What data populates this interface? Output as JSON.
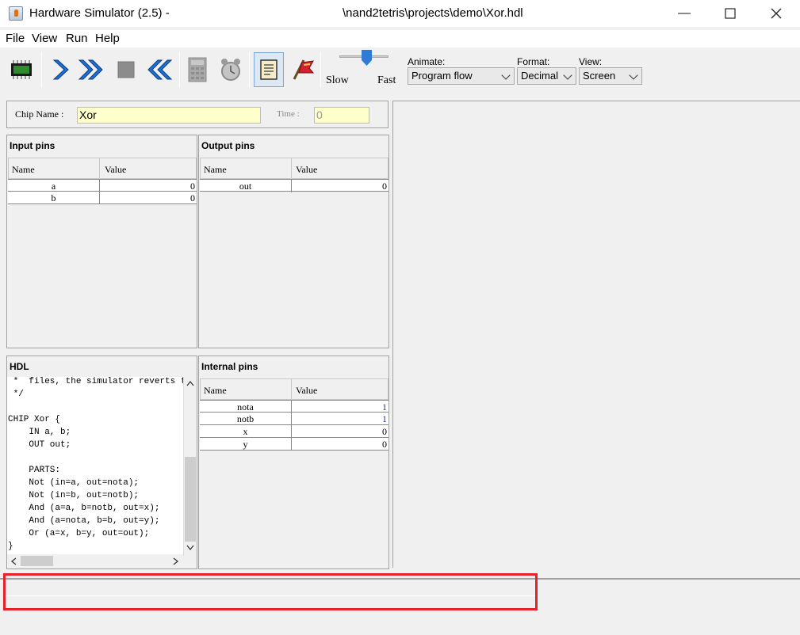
{
  "window": {
    "title": "Hardware Simulator (2.5) -",
    "path": "\\nand2tetris\\projects\\demo\\Xor.hdl",
    "minimize_glyph": "—",
    "maximize_glyph": "☐",
    "close_glyph": "✕"
  },
  "menu": {
    "file": "File",
    "view": "View",
    "run": "Run",
    "help": "Help"
  },
  "toolbar": {
    "speed_slow": "Slow",
    "speed_fast": "Fast",
    "speed_level": 0.55,
    "animate_label": "Animate:",
    "animate_value": "Program flow",
    "format_label": "Format:",
    "format_value": "Decimal",
    "view_label": "View:",
    "view_value": "Screen"
  },
  "chip": {
    "name_label": "Chip Name :",
    "name_value": "Xor",
    "time_label": "Time :",
    "time_value": "0"
  },
  "input_pins": {
    "title": "Input pins",
    "col_name": "Name",
    "col_value": "Value",
    "rows": [
      {
        "name": "a",
        "value": "0"
      },
      {
        "name": "b",
        "value": "0"
      }
    ]
  },
  "output_pins": {
    "title": "Output pins",
    "col_name": "Name",
    "col_value": "Value",
    "rows": [
      {
        "name": "out",
        "value": "0"
      }
    ]
  },
  "internal_pins": {
    "title": "Internal pins",
    "col_name": "Name",
    "col_value": "Value",
    "rows": [
      {
        "name": "nota",
        "value": "1"
      },
      {
        "name": "notb",
        "value": "1"
      },
      {
        "name": "x",
        "value": "0"
      },
      {
        "name": "y",
        "value": "0"
      }
    ]
  },
  "hdl": {
    "title": "HDL",
    "lines": [
      " *  files, the simulator reverts to u",
      " */",
      "",
      "CHIP Xor {",
      "    IN a, b;",
      "    OUT out;",
      "",
      "    PARTS:",
      "    Not (in=a, out=nota);",
      "    Not (in=b, out=notb);",
      "    And (a=a, b=notb, out=x);",
      "    And (a=nota, b=b, out=y);",
      "    Or (a=x, b=y, out=out);",
      "}"
    ]
  },
  "colors": {
    "highlight": "#e8202a",
    "chip_field": "#ffffcc",
    "slider": "#2f7bd6",
    "changed_value": "#1f2fbf"
  }
}
